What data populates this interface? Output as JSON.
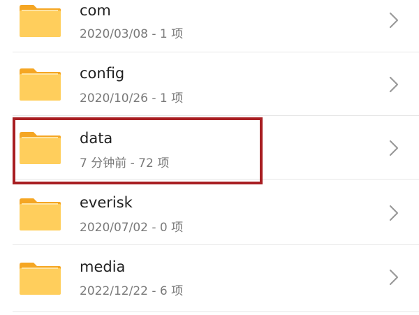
{
  "colors": {
    "folder_body": "#FFCE5C",
    "folder_tab": "#F5A623",
    "folder_inner": "#FFE3A0",
    "highlight_border": "#A81E22",
    "name_text": "#1F1F1F",
    "meta_text": "#7A7A7A",
    "chevron": "#9A9A9A"
  },
  "icons": {
    "folder": "folder-icon",
    "chevron": "chevron-right-icon"
  },
  "items": [
    {
      "name": "com",
      "meta": "2020/03/08 - 1 项"
    },
    {
      "name": "config",
      "meta": "2020/10/26 - 1 项"
    },
    {
      "name": "data",
      "meta": "7 分钟前 - 72 项",
      "highlighted": true
    },
    {
      "name": "everisk",
      "meta": "2020/07/02 - 0 项"
    },
    {
      "name": "media",
      "meta": "2022/12/22 - 6 项"
    }
  ]
}
